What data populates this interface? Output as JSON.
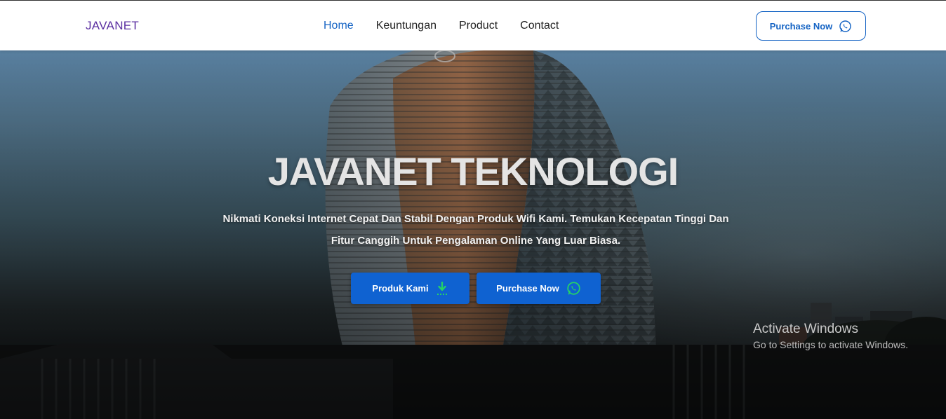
{
  "navbar": {
    "brand": "JAVANET",
    "links": [
      {
        "label": "Home",
        "active": true
      },
      {
        "label": "Keuntungan",
        "active": false
      },
      {
        "label": "Product",
        "active": false
      },
      {
        "label": "Contact",
        "active": false
      }
    ],
    "purchase_label": "Purchase Now",
    "purchase_icon": "whatsapp-icon"
  },
  "hero": {
    "title": "JAVANET TEKNOLOGI",
    "subtitle": "Nikmati Koneksi Internet Cepat Dan Stabil Dengan Produk Wifi Kami. Temukan Kecepatan Tinggi Dan Fitur Canggih Untuk Pengalaman Online Yang Luar Biasa.",
    "buttons": {
      "products_label": "Produk Kami",
      "products_icon": "download-icon",
      "purchase_label": "Purchase Now",
      "purchase_icon": "whatsapp-icon"
    }
  },
  "watermark": {
    "line1": "Activate Windows",
    "line2": "Go to Settings to activate Windows."
  },
  "colors": {
    "brand": "#5b2fa0",
    "accent": "#1463c4",
    "button": "#0f62d1",
    "icon_green": "#25d366"
  }
}
